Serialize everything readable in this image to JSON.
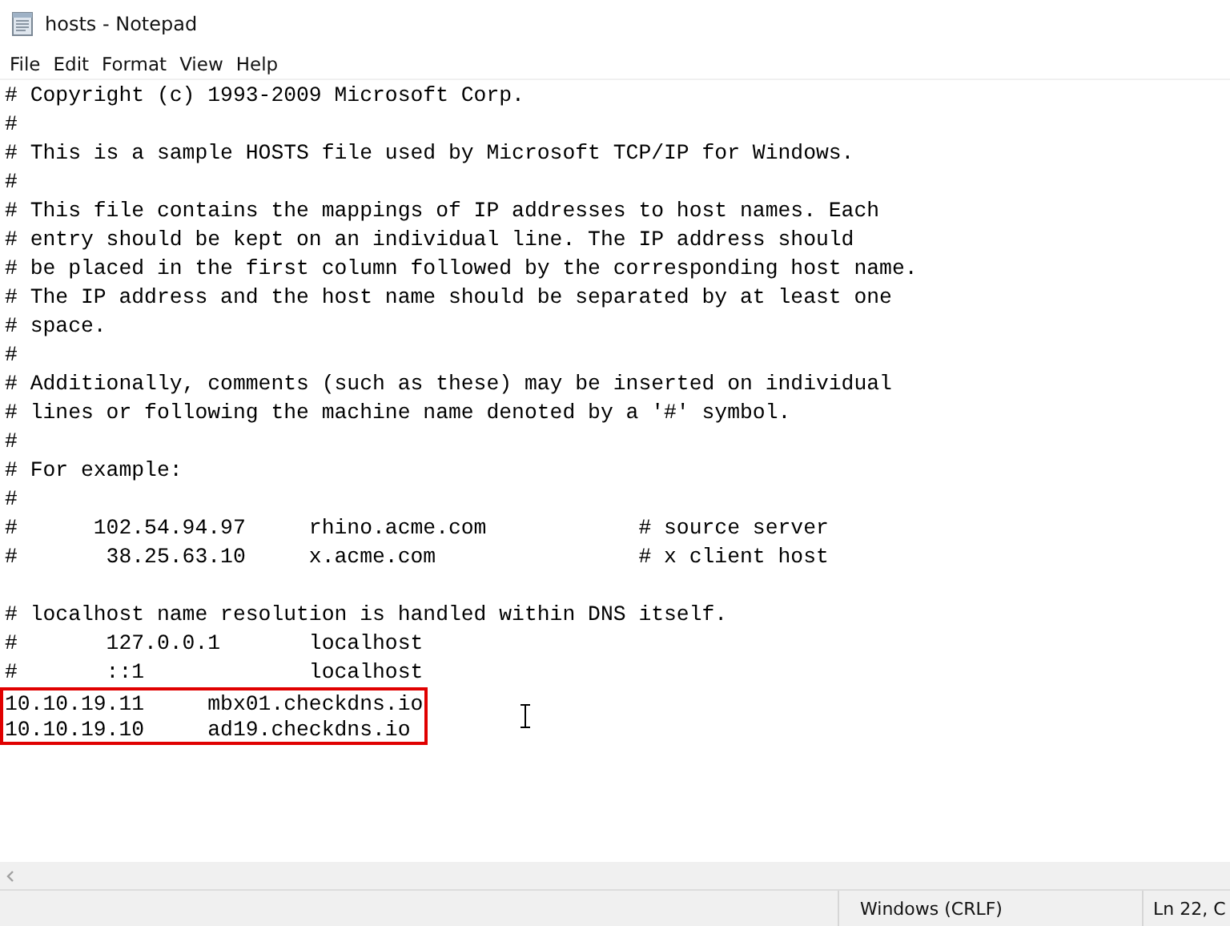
{
  "window": {
    "title": "hosts - Notepad"
  },
  "menu": [
    "File",
    "Edit",
    "Format",
    "View",
    "Help"
  ],
  "lines": [
    "# Copyright (c) 1993-2009 Microsoft Corp.",
    "#",
    "# This is a sample HOSTS file used by Microsoft TCP/IP for Windows.",
    "#",
    "# This file contains the mappings of IP addresses to host names. Each",
    "# entry should be kept on an individual line. The IP address should",
    "# be placed in the first column followed by the corresponding host name.",
    "# The IP address and the host name should be separated by at least one",
    "# space.",
    "#",
    "# Additionally, comments (such as these) may be inserted on individual",
    "# lines or following the machine name denoted by a '#' symbol.",
    "#",
    "# For example:",
    "#",
    "#      102.54.94.97     rhino.acme.com            # source server",
    "#       38.25.63.10     x.acme.com                # x client host",
    {
      "kind": "blank"
    },
    "# localhost name resolution is handled within DNS itself.",
    "#       127.0.0.1       localhost",
    "#       ::1             localhost"
  ],
  "highlighted_lines": [
    "10.10.19.11     mbx01.checkdns.io",
    "10.10.19.10     ad19.checkdns.io"
  ],
  "status_bar": [
    "Windows (CRLF)",
    "Ln 22, C"
  ]
}
